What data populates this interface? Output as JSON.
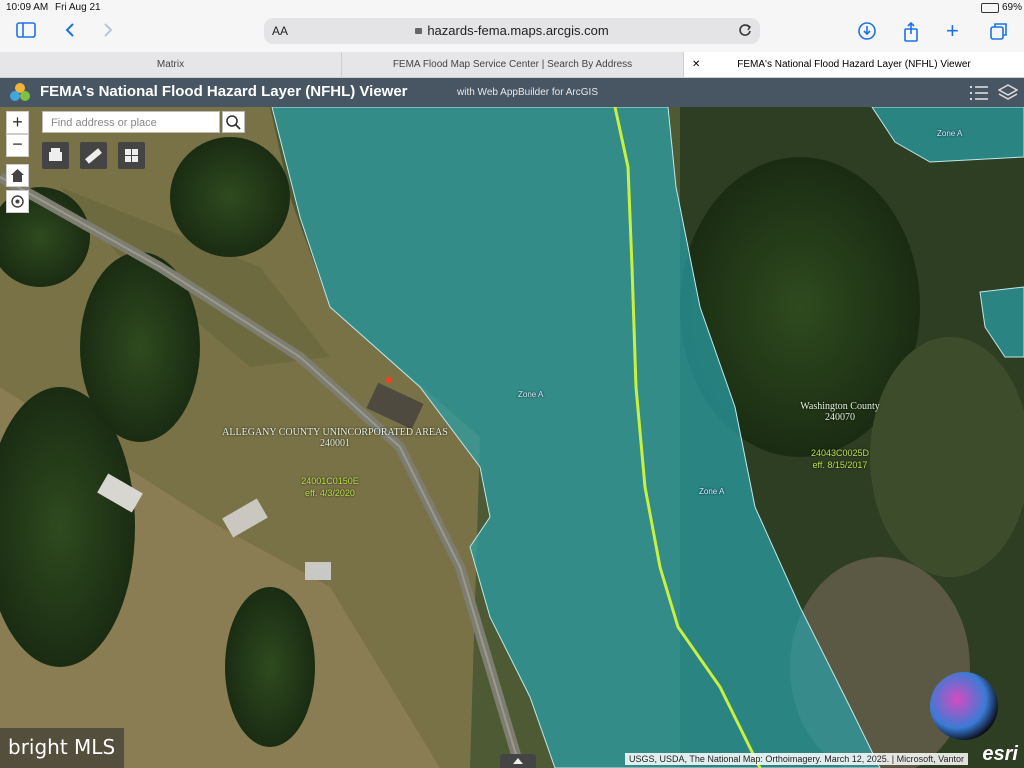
{
  "status_bar": {
    "time": "10:09 AM",
    "date": "Fri Aug 21",
    "battery": "69%"
  },
  "browser": {
    "text_size_label": "AA",
    "url": "hazards-fema.maps.arcgis.com",
    "tabs": [
      {
        "label": "Matrix"
      },
      {
        "label": "FEMA Flood Map Service Center | Search By Address"
      },
      {
        "label": "FEMA's National Flood Hazard Layer (NFHL) Viewer"
      }
    ]
  },
  "app": {
    "title": "FEMA's National Flood Hazard Layer (NFHL) Viewer",
    "subtitle": "with Web AppBuilder for ArcGIS"
  },
  "search": {
    "placeholder": "Find address or place"
  },
  "map_labels": {
    "allegany_name": "ALLEGANY COUNTY UNINCORPORATED AREAS",
    "allegany_code": "240001",
    "allegany_panel": "24001C0150E",
    "allegany_eff": "eff. 4/3/2020",
    "washington_name": "Washington County",
    "washington_code": "240070",
    "washington_panel": "24043C0025D",
    "washington_eff": "eff. 8/15/2017",
    "zone_a": "Zone A"
  },
  "attribution": "USGS, USDA, The National Map: Orthoimagery. March 12, 2025. | Microsoft, Vantor",
  "watermark": "bright MLS",
  "esri_logo": "esri",
  "colors": {
    "flood_zone": "#2aa0a8",
    "boundary_line": "#c8f040",
    "header": "#485563"
  }
}
